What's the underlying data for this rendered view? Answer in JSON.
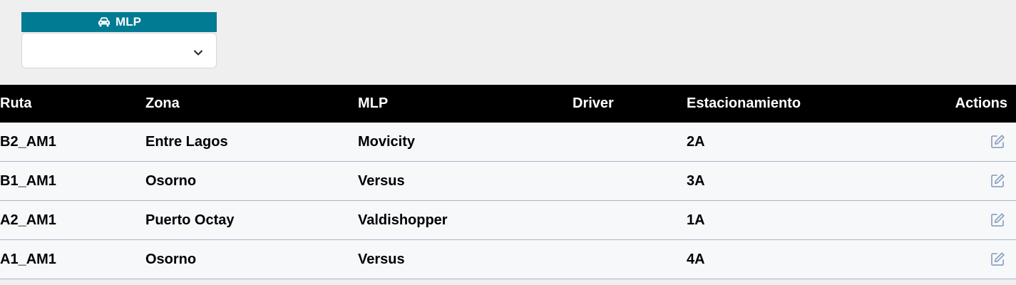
{
  "filter": {
    "label": "MLP",
    "icon": "car-icon",
    "selected_value": "",
    "header_color": "#007b93"
  },
  "table": {
    "headers": {
      "ruta": "Ruta",
      "zona": "Zona",
      "mlp": "MLP",
      "driver": "Driver",
      "estacionamiento": "Estacionamiento",
      "actions": "Actions"
    },
    "rows": [
      {
        "ruta": "B2_AM1",
        "zona": "Entre Lagos",
        "mlp": "Movicity",
        "driver": "",
        "estacionamiento": "2A",
        "action_icon": "edit-icon"
      },
      {
        "ruta": "B1_AM1",
        "zona": "Osorno",
        "mlp": "Versus",
        "driver": "",
        "estacionamiento": "3A",
        "action_icon": "edit-icon"
      },
      {
        "ruta": "A2_AM1",
        "zona": "Puerto Octay",
        "mlp": "Valdishopper",
        "driver": "",
        "estacionamiento": "1A",
        "action_icon": "edit-icon"
      },
      {
        "ruta": "A1_AM1",
        "zona": "Osorno",
        "mlp": "Versus",
        "driver": "",
        "estacionamiento": "4A",
        "action_icon": "edit-icon"
      }
    ]
  }
}
